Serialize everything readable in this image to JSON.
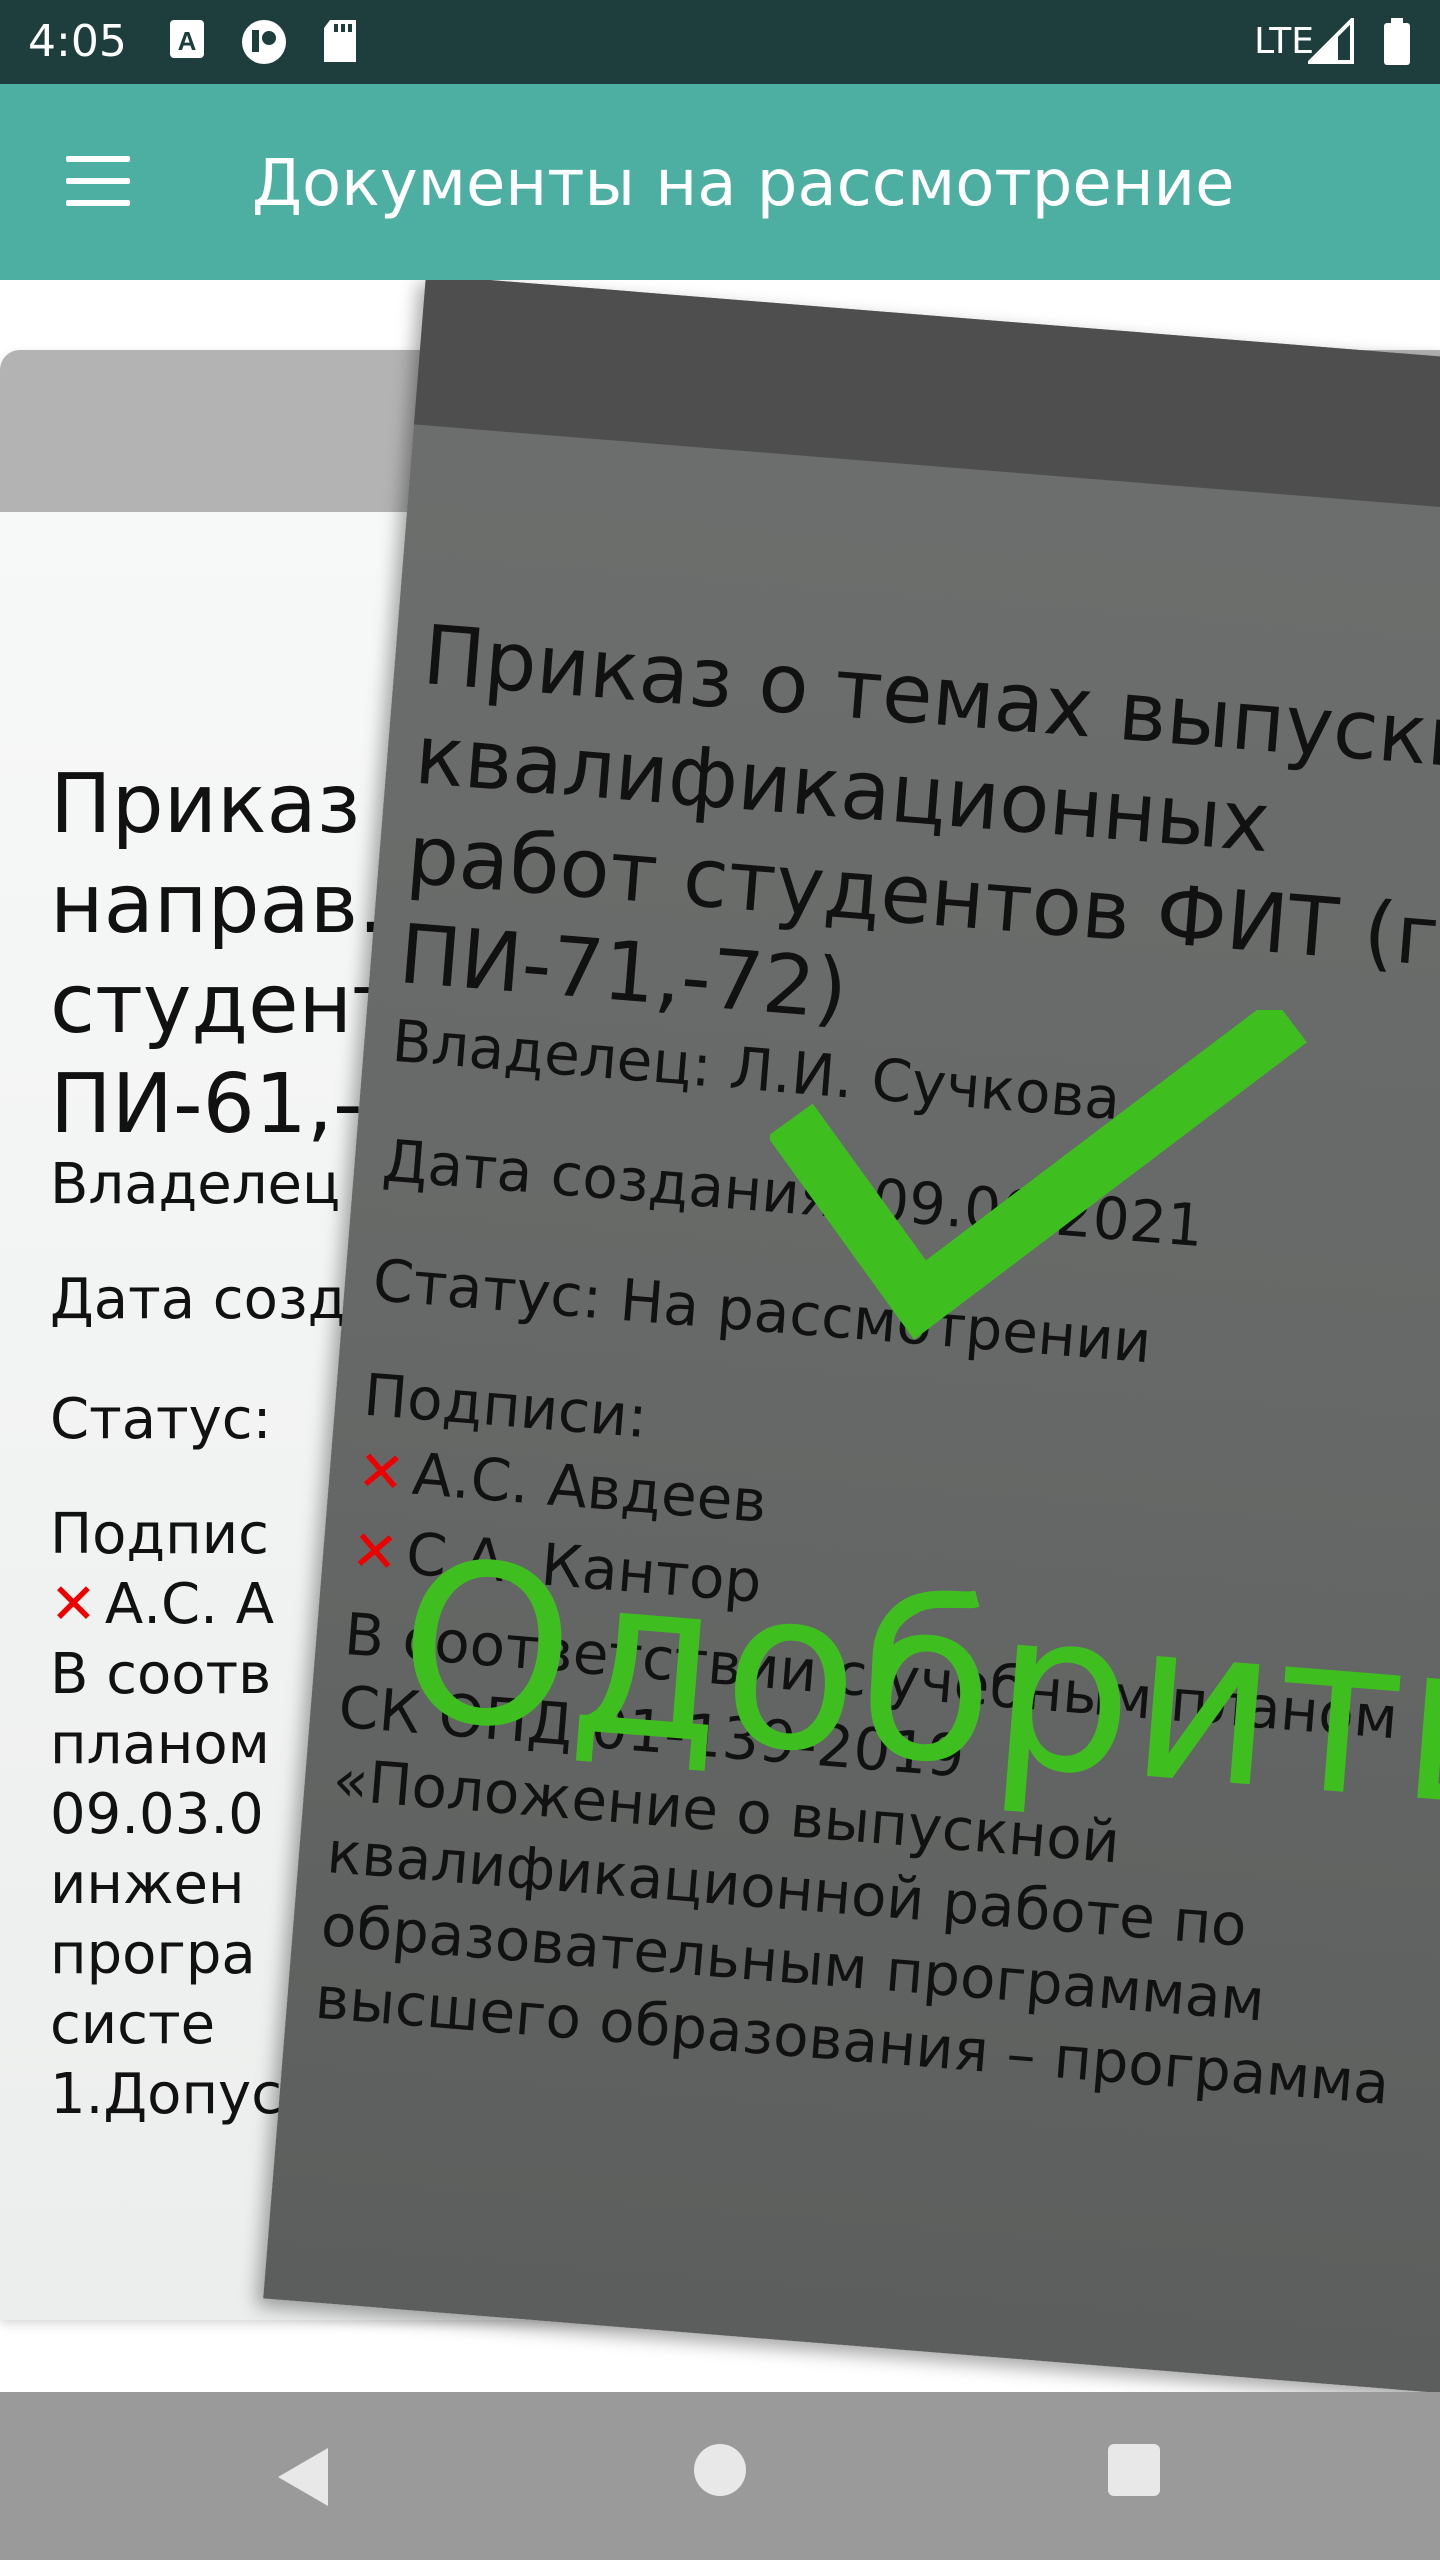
{
  "status_bar": {
    "time": "4:05",
    "network": "LTE",
    "icons": [
      "a11y-icon",
      "media-icon",
      "sd-card-icon",
      "signal-icon",
      "battery-icon"
    ]
  },
  "app_bar": {
    "title": "Документы на рассмотрение",
    "menu_icon": "hamburger-menu-icon",
    "color": "#4daea2"
  },
  "back_card": {
    "title_lines": [
      "Приказ",
      "направ.",
      "студент",
      "ПИ-61,-"
    ],
    "owner": "Владелец",
    "date": "Дата созд",
    "status": "Статус:",
    "signatures_label": "Подпис",
    "signer": "А.С. А",
    "body_lines": [
      "В соотв",
      "планом",
      "09.03.0",
      "инжен",
      "програ",
      "систе",
      "1.Допус"
    ]
  },
  "front_card": {
    "title_lines": [
      "Приказ о темах выпускн",
      "квалификационных",
      "работ студентов ФИТ (гр",
      "ПИ-71,-72)"
    ],
    "owner": "Владелец: Л.И. Сучкова",
    "date": "Дата создания: 09.06.2021",
    "status": "Статус: На рассмотрении",
    "signatures_label": "Подписи:",
    "signers": [
      "А.С. Авдеев",
      "С.А. Кантор"
    ],
    "body_lines": [
      "В соответствии с учебным планом",
      "СК ОПД 01-139-2019",
      "«Положение о выпускной",
      "квалификационной работе по",
      "образовательным программам",
      "высшего образования – программа"
    ]
  },
  "overlay": {
    "label": "Одобрить",
    "icon": "checkmark-icon",
    "color": "#3fbf1f"
  },
  "nav_bar": {
    "buttons": [
      "back-icon",
      "home-icon",
      "recents-icon"
    ]
  }
}
